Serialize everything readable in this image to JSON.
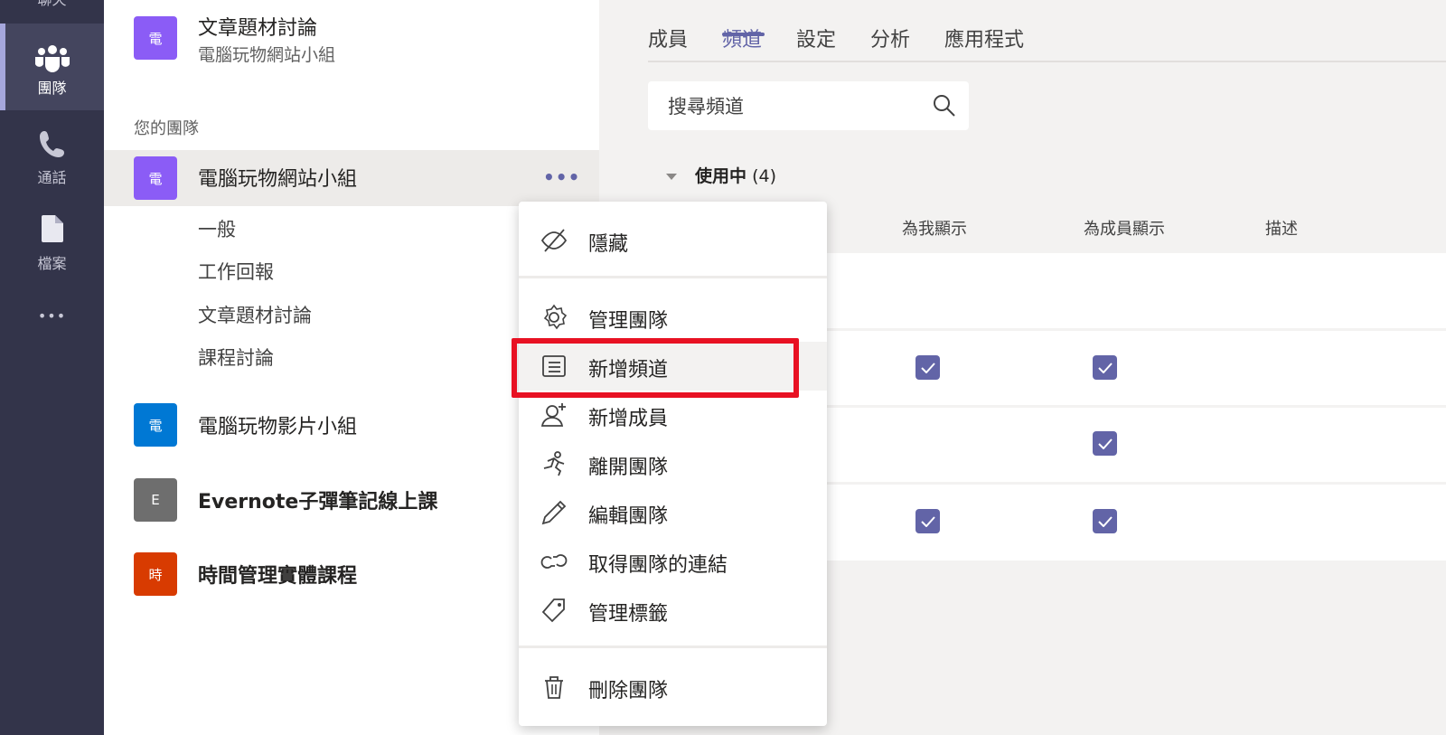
{
  "rail": {
    "items": [
      {
        "icon": "chat-icon",
        "label": "聊天"
      },
      {
        "icon": "teams-icon",
        "label": "團隊",
        "active": true
      },
      {
        "icon": "calls-icon",
        "label": "通話"
      },
      {
        "icon": "files-icon",
        "label": "檔案"
      },
      {
        "icon": "more-apps-icon",
        "label": "•••"
      }
    ]
  },
  "teams": {
    "top_item": {
      "avatar": "電",
      "name": "文章題材討論",
      "sub": "電腦玩物網站小組"
    },
    "section_label": "您的團隊",
    "selected_team": {
      "avatar": "電",
      "name": "電腦玩物網站小組",
      "more": "•••"
    },
    "channels": [
      "一般",
      "工作回報",
      "文章題材討論",
      "課程討論"
    ],
    "others": [
      {
        "avatar": "電",
        "name": "電腦玩物影片小組",
        "color": "#0078d4",
        "bold": false
      },
      {
        "avatar": "E",
        "name": "Evernote子彈筆記線上課",
        "color": "#6e6e6e",
        "bold": true
      },
      {
        "avatar": "時",
        "name": "時間管理實體課程",
        "color": "#d83b01",
        "bold": true
      }
    ],
    "accent_color": "#8b5cf6"
  },
  "main": {
    "tabs": [
      "成員",
      "頻道",
      "設定",
      "分析",
      "應用程式"
    ],
    "active_tab": "頻道",
    "search_placeholder": "搜尋頻道",
    "section_title": "使用中",
    "section_count": "(4)",
    "columns": [
      "為我顯示",
      "為成員顯示",
      "描述"
    ],
    "rows": [
      {
        "show_me": false,
        "show_members": false
      },
      {
        "show_me": true,
        "show_members": true
      },
      {
        "show_me": false,
        "show_members": true
      },
      {
        "show_me": true,
        "show_members": true
      }
    ]
  },
  "menu": {
    "items": [
      {
        "icon": "hide-icon",
        "label": "隱藏"
      },
      {
        "icon": "gear-icon",
        "label": "管理團隊"
      },
      {
        "icon": "add-channel-icon",
        "label": "新增頻道",
        "highlighted": true
      },
      {
        "icon": "add-member-icon",
        "label": "新增成員"
      },
      {
        "icon": "leave-team-icon",
        "label": "離開團隊"
      },
      {
        "icon": "edit-icon",
        "label": "編輯團隊"
      },
      {
        "icon": "link-icon",
        "label": "取得團隊的連結"
      },
      {
        "icon": "tag-icon",
        "label": "管理標籤"
      },
      {
        "icon": "trash-icon",
        "label": "刪除團隊"
      }
    ]
  },
  "colors": {
    "rail_bg": "#33344a",
    "brand": "#6264a7",
    "highlight_box": "#e81123"
  }
}
